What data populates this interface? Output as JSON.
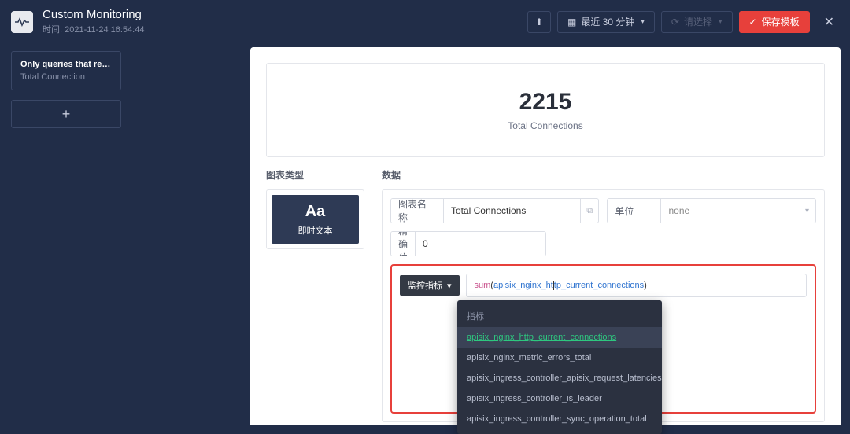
{
  "header": {
    "title": "Custom Monitoring",
    "time_label": "时间: 2021-11-24 16:54:44",
    "range_label": "最近 30 分钟",
    "refresh_placeholder": "请选择",
    "save_label": "保存模板"
  },
  "sidebar": {
    "card_title": "Only queries that return sin…",
    "card_sub": "Total Connection",
    "add_glyph": "+"
  },
  "preview": {
    "value": "2215",
    "label": "Total Connections"
  },
  "sections": {
    "type": "图表类型",
    "data": "数据"
  },
  "type_box": {
    "glyph": "Aa",
    "label": "即时文本"
  },
  "fields": {
    "name_label": "图表名称",
    "name_value": "Total Connections",
    "unit_label": "单位",
    "unit_value": "none",
    "precision_label": "精确位",
    "precision_value": "0",
    "metric_pill": "监控指标"
  },
  "query": {
    "fn": "sum",
    "open": "(",
    "close": ")",
    "name_a": "apisix_nginx_ht",
    "name_b": "tp_current_connections"
  },
  "dropdown": {
    "heading": "指标",
    "items": [
      "apisix_nginx_http_current_connections",
      "apisix_nginx_metric_errors_total",
      "apisix_ingress_controller_apisix_request_latencies",
      "apisix_ingress_controller_is_leader",
      "apisix_ingress_controller_sync_operation_total"
    ]
  }
}
